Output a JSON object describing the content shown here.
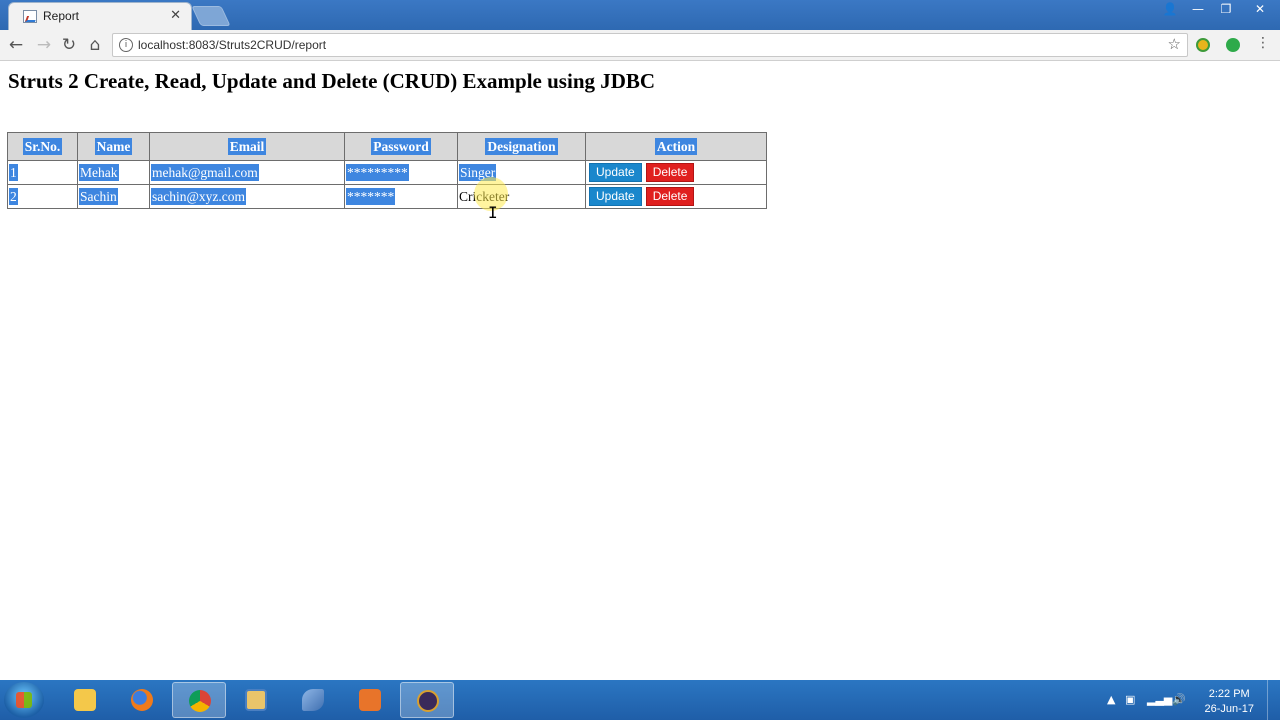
{
  "browser": {
    "tab_title": "Report",
    "tab_close": "✕",
    "url": "localhost:8083/Struts2CRUD/report",
    "icons": {
      "back": "arrow-left-icon",
      "forward": "arrow-right-icon",
      "reload": "reload-icon",
      "home": "home-icon",
      "info": "info-icon",
      "bookmark": "star-icon",
      "menu": "kebab-menu-icon"
    },
    "window_buttons": [
      "👤",
      "—",
      "❐",
      "✕"
    ]
  },
  "page": {
    "title": "Struts 2 Create, Read, Update and Delete (CRUD) Example using JDBC",
    "table": {
      "headers": [
        "Sr.No.",
        "Name",
        "Email",
        "Password",
        "Designation",
        "Action"
      ],
      "rows": [
        {
          "srno": "1",
          "name": "Mehak",
          "email": "mehak@gmail.com",
          "password": "*********",
          "designation": "Singer",
          "update": "Update",
          "delete": "Delete"
        },
        {
          "srno": "2",
          "name": "Sachin",
          "email": "sachin@xyz.com",
          "password": "*******",
          "designation": "Cricketer",
          "update": "Update",
          "delete": "Delete"
        }
      ]
    },
    "colors": {
      "selection": "#3e86e0",
      "update_button": "#1a87cc",
      "delete_button": "#e0201f",
      "header_bg": "#d8d8d8"
    }
  },
  "taskbar": {
    "apps": [
      "windows-explorer",
      "firefox",
      "chrome",
      "file-manager",
      "dolphin-app",
      "java-app",
      "java-ee-ide"
    ],
    "clock_time": "2:22 PM",
    "clock_date": "26-Jun-17",
    "tray_arrow": "▲"
  }
}
